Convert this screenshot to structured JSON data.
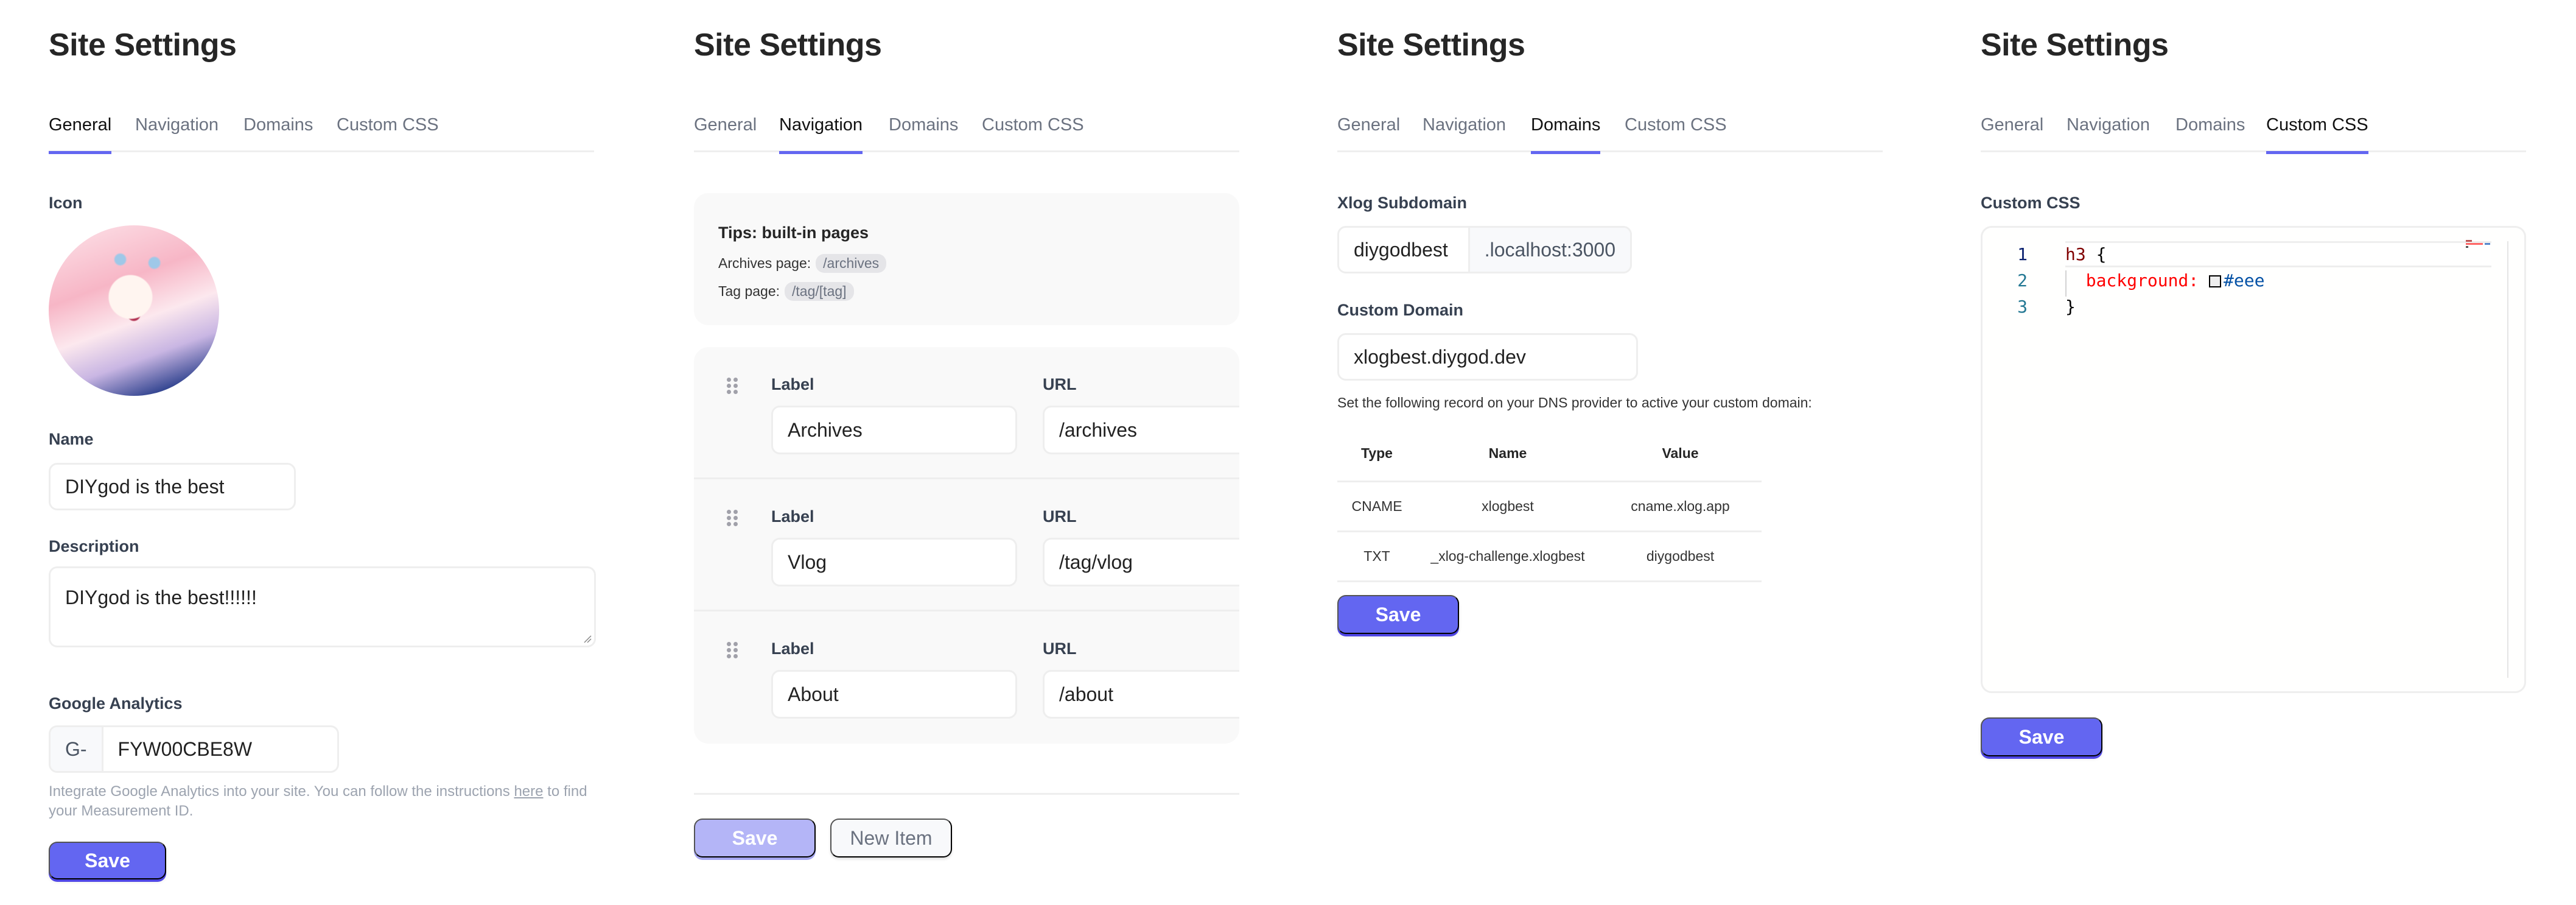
{
  "accent_color": "#6366f1",
  "tabs": [
    "General",
    "Navigation",
    "Domains",
    "Custom CSS"
  ],
  "panels": {
    "general": {
      "title": "Site Settings",
      "active_tab": "General",
      "icon_label": "Icon",
      "avatar_icon": "anime-avatar-image",
      "name_label": "Name",
      "name_value": "DIYgod is the best",
      "description_label": "Description",
      "description_value": "DIYgod is the best!!!!!!",
      "ga_label": "Google Analytics",
      "ga_prefix": "G-",
      "ga_value": "FYW00CBE8W",
      "ga_help_before": "Integrate Google Analytics into your site. You can follow the instructions ",
      "ga_help_link": "here",
      "ga_help_after": " to find your Measurement ID.",
      "save_label": "Save"
    },
    "navigation": {
      "title": "Site Settings",
      "active_tab": "Navigation",
      "tips_title": "Tips: built-in pages",
      "tips": [
        {
          "label": "Archives page:",
          "path": "/archives"
        },
        {
          "label": "Tag page:",
          "path": "/tag/[tag]"
        }
      ],
      "label_header": "Label",
      "url_header": "URL",
      "items": [
        {
          "label": "Archives",
          "url": "/archives"
        },
        {
          "label": "Vlog",
          "url": "/tag/vlog"
        },
        {
          "label": "About",
          "url": "/about"
        }
      ],
      "save_label": "Save",
      "save_disabled": true,
      "new_item_label": "New Item"
    },
    "domains": {
      "title": "Site Settings",
      "active_tab": "Domains",
      "subdomain_label": "Xlog Subdomain",
      "subdomain_value": "diygodbest",
      "subdomain_suffix": ".localhost:3000",
      "custom_domain_label": "Custom Domain",
      "custom_domain_value": "xlogbest.diygod.dev",
      "dns_description": "Set the following record on your DNS provider to active your custom domain:",
      "dns_columns": [
        "Type",
        "Name",
        "Value"
      ],
      "dns_records": [
        [
          "CNAME",
          "xlogbest",
          "cname.xlog.app"
        ],
        [
          "TXT",
          "_xlog-challenge.xlogbest",
          "diygodbest"
        ]
      ],
      "save_label": "Save"
    },
    "custom_css": {
      "title": "Site Settings",
      "active_tab": "Custom CSS",
      "editor_label": "Custom CSS",
      "line_numbers": [
        "1",
        "2",
        "3"
      ],
      "code": {
        "selector": "h3",
        "open_brace": " {",
        "property": "background:",
        "value": "#eee",
        "close_brace": "}"
      },
      "save_label": "Save"
    }
  }
}
